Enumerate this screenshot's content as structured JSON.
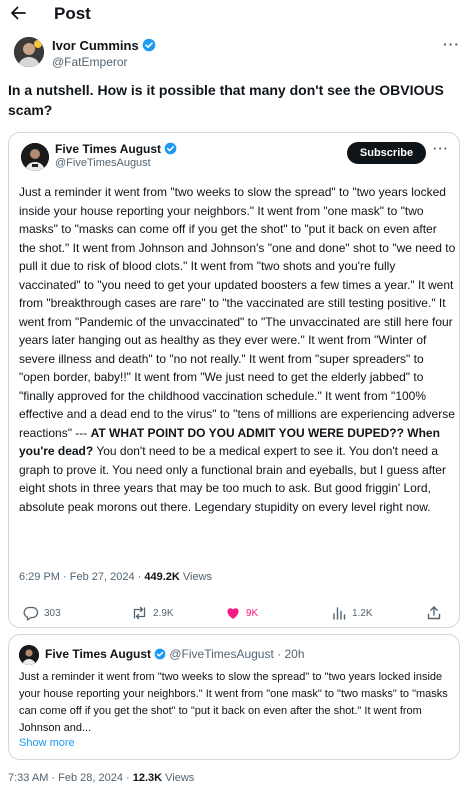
{
  "header": {
    "title": "Post"
  },
  "author": {
    "name": "Ivor Cummins",
    "handle": "@FatEmperor",
    "more": "···"
  },
  "post": {
    "text": "In a nutshell. How is it possible that many don't see the OBVIOUS scam?"
  },
  "quoted": {
    "name": "Five Times August",
    "handle": "@FiveTimesAugust",
    "subscribe_label": "Subscribe",
    "more": "···",
    "body_intro": "Just a reminder it went from \"two weeks to slow the spread\" to \"two years locked inside your house reporting your neighbors.\" It went from \"one mask\" to \"two masks\" to \"masks can come off if you get the shot\" to \"put it back on even after the shot.\" It went from Johnson and Johnson's \"one and done\" shot to \"we need to pull it due to risk of blood clots.\" It went from \"two shots and you're fully vaccinated\" to \"you need to get your updated boosters a few times a year.\" It went from \"breakthrough cases are rare\" to \"the vaccinated are still testing positive.\" It went from \"Pandemic of the unvaccinated\" to \"The unvaccinated are still here four years later hanging out as healthy as they ever were.\" It went from \"Winter of severe illness and death\" to \"no not really.\" It went from \"super spreaders\" to \"open border, baby!!\" It went from \"We just need to get the elderly jabbed\" to \"finally approved for the childhood vaccination schedule.\" It went from \"100% effective and a dead end to the virus\" to \"tens of millions are experiencing adverse reactions\" --- ",
    "body_bold": "AT WHAT POINT DO YOU ADMIT YOU WERE DUPED?? When you're dead?",
    "body_outro": " You don't need to be a medical expert to see it. You don't need a graph to prove it. You need only a functional brain and eyeballs, but I guess after eight shots in three years that may be too much to ask. But good friggin' Lord, absolute peak morons out there. Legendary stupidity on every level right now.",
    "timestamp": "6:29 PM · Feb 27, 2024 · ",
    "views": "449.2K",
    "views_label": " Views",
    "replies": "303",
    "reposts": "2.9K",
    "likes": "9K",
    "bookmarks": "1.2K",
    "colors": {
      "like": "#f91880",
      "link": "#1d9bf0",
      "verified": "#1d9bf0"
    }
  },
  "quoted2": {
    "name": "Five Times August",
    "handle_time": "@FiveTimesAugust · 20h",
    "body": "Just a reminder it went from \"two weeks to slow the spread\" to \"two years locked inside your house reporting your neighbors.\" It went from \"one mask\" to \"two masks\" to \"masks can come off if you get the shot\" to \"put it back on even after the shot.\" It went from Johnson and...",
    "show_more": "Show more"
  },
  "meta": {
    "timestamp": "7:33 AM · Feb 28, 2024 · ",
    "views": "12.3K",
    "views_label": " Views"
  }
}
